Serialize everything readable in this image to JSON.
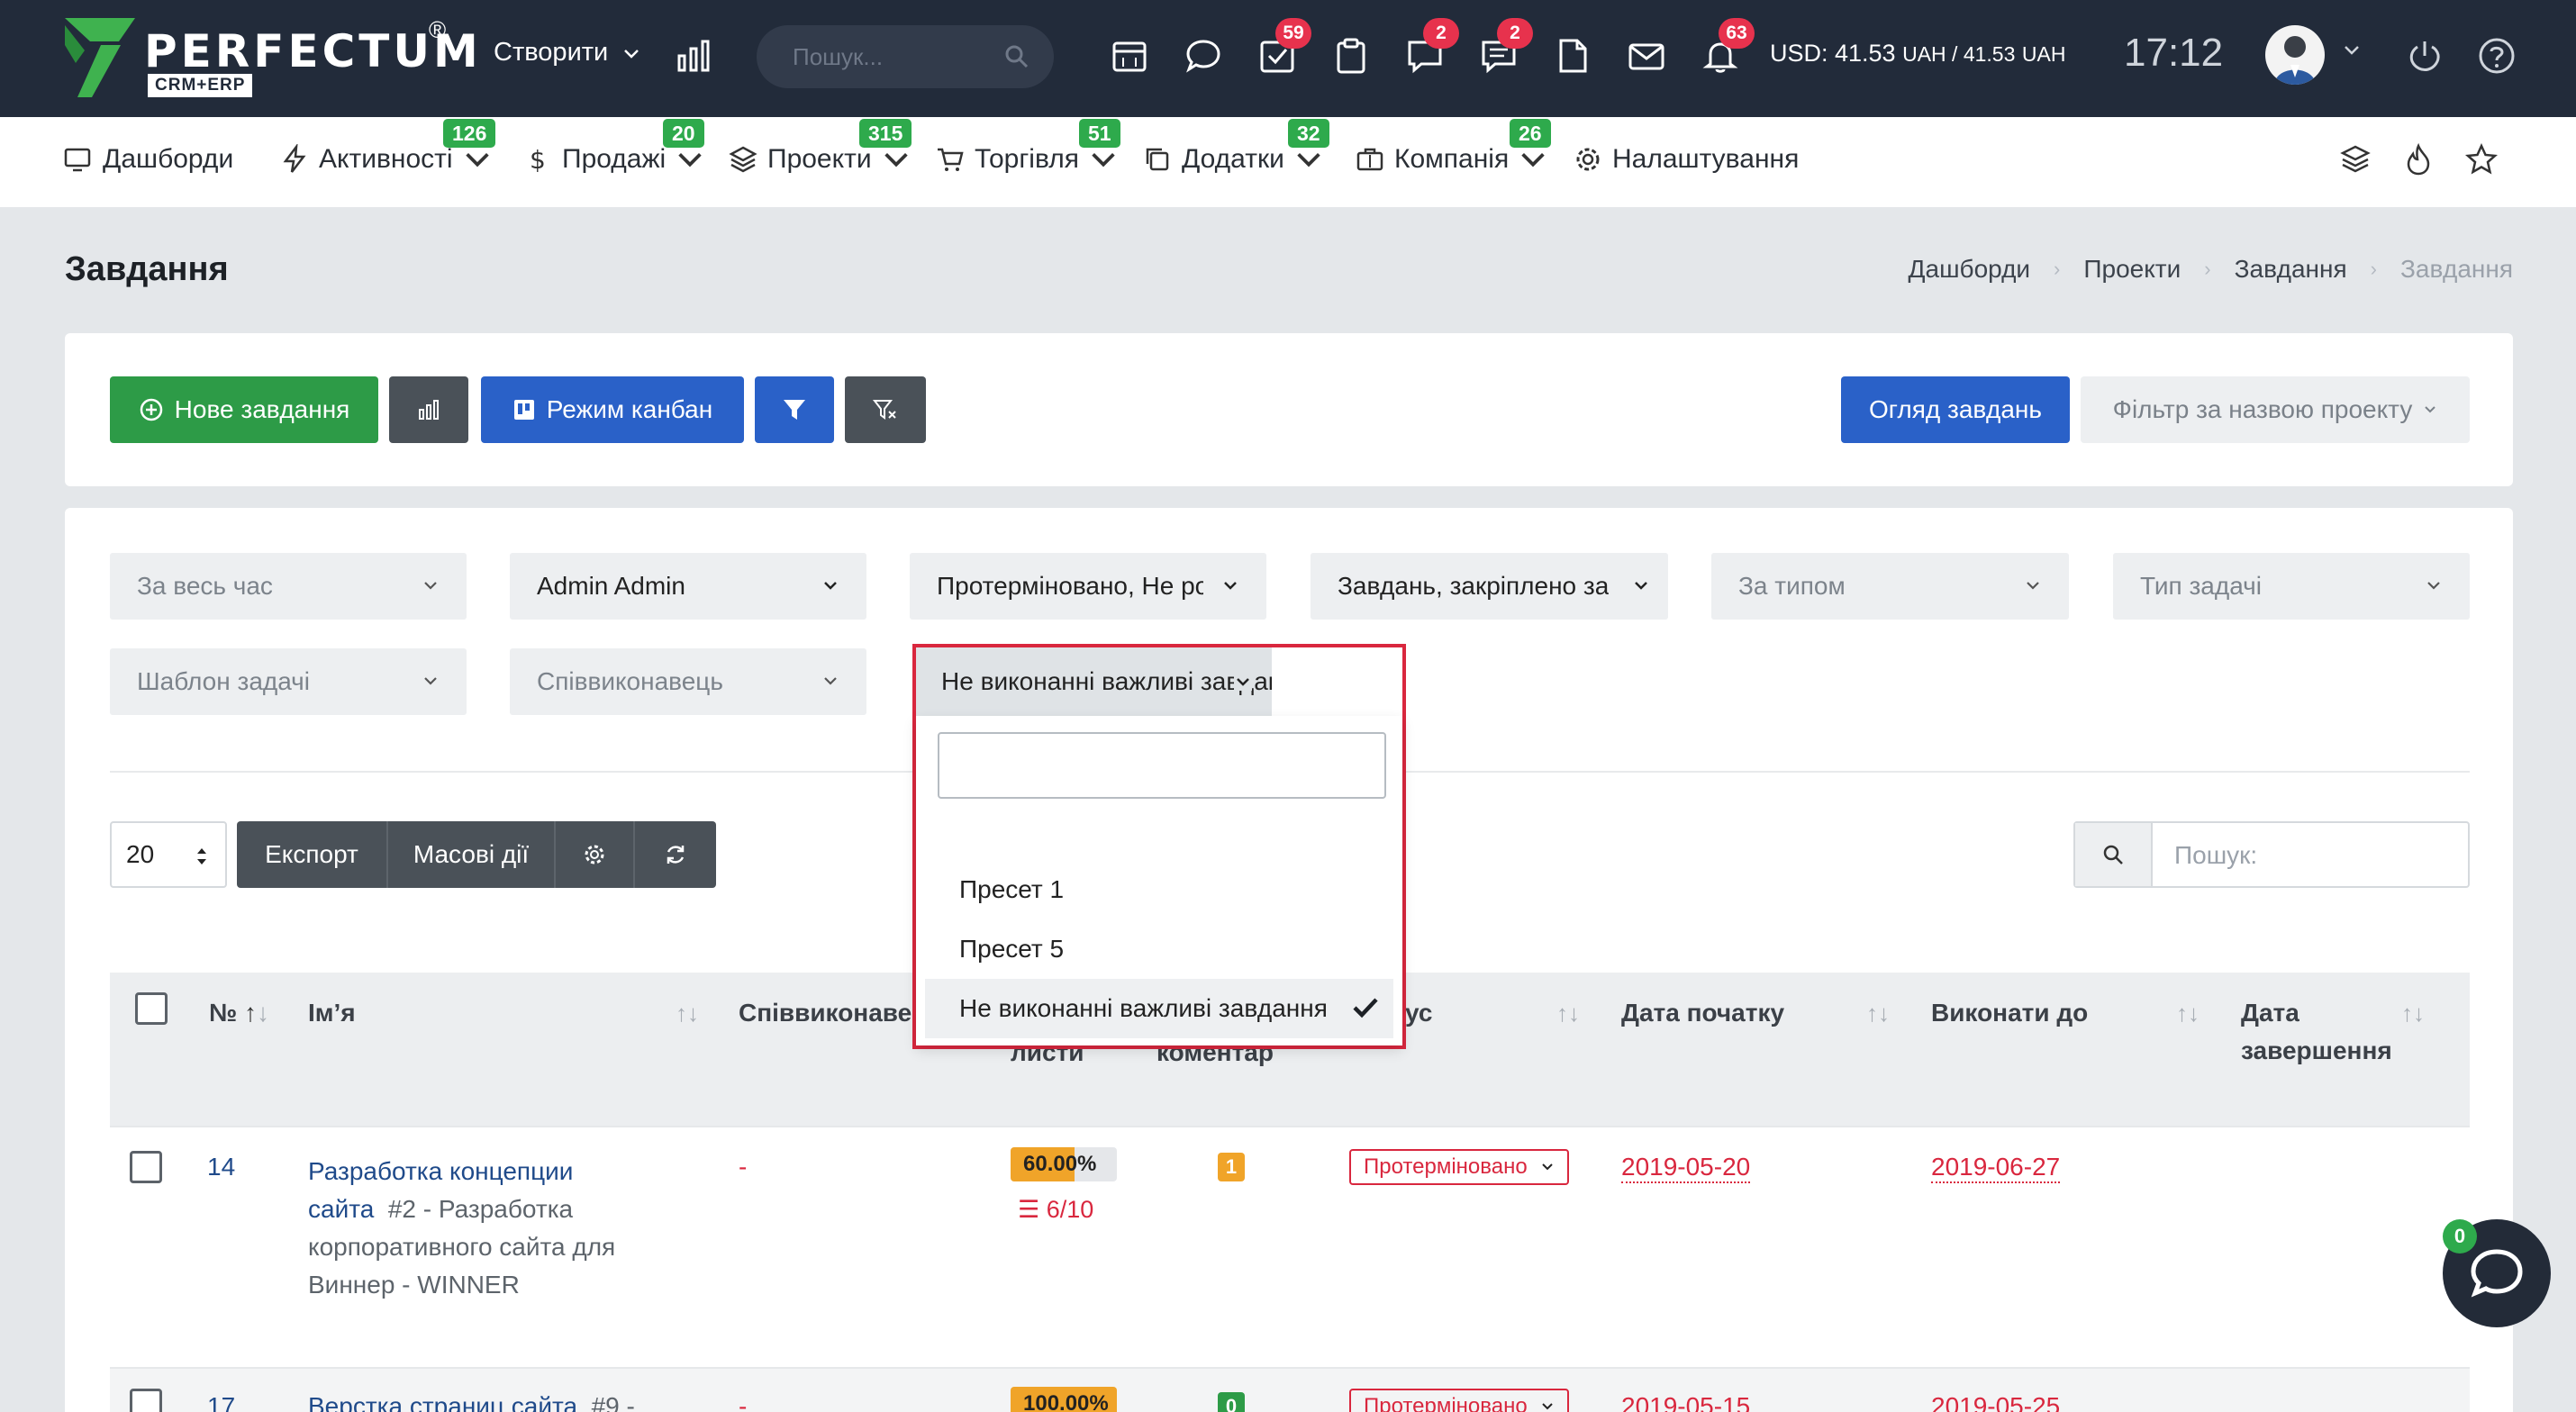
{
  "app": {
    "brand": "PERFECTUM",
    "brand_reg": "®",
    "brand_sub": "CRM+ERP",
    "create_label": "Створити",
    "search_placeholder": "Пошук...",
    "currency_usd": "USD: 41.53",
    "currency_mid": "UAH / 41.53",
    "currency_uah": "UAH",
    "time": "17:12",
    "badges": {
      "tasks": "59",
      "chat": "2",
      "discuss": "2",
      "notifications": "63"
    }
  },
  "nav": [
    {
      "label": "Дашборди",
      "badge": ""
    },
    {
      "label": "Активності",
      "badge": "126"
    },
    {
      "label": "Продажі",
      "badge": "20"
    },
    {
      "label": "Проекти",
      "badge": "315"
    },
    {
      "label": "Торгівля",
      "badge": "51"
    },
    {
      "label": "Додатки",
      "badge": "32"
    },
    {
      "label": "Компанія",
      "badge": "26"
    },
    {
      "label": "Налаштування",
      "badge": ""
    }
  ],
  "page": {
    "title": "Завдання",
    "breadcrumb": [
      "Дашборди",
      "Проекти",
      "Завдання",
      "Завдання"
    ]
  },
  "toolbar": {
    "new_task": "Нове завдання",
    "kanban": "Режим канбан",
    "overview": "Огляд завдань",
    "project_filter": "Фільтр за назвою проекту"
  },
  "filters": {
    "period": "За весь час",
    "assignee": "Admin Admin",
    "status": "Протерміновано, Не розпочато",
    "assigned_to": "Завдань, закріплено за",
    "by_type": "За типом",
    "task_type": "Тип задачі",
    "template": "Шаблон задачі",
    "coexecutor": "Співвиконавець",
    "preset": "Не виконанні важливі завдання"
  },
  "dropdown": {
    "search_value": "",
    "options": [
      {
        "label": "Пресет 1",
        "selected": false
      },
      {
        "label": "Пресет 5",
        "selected": false
      },
      {
        "label": "Не виконанні важливі завдання",
        "selected": true
      }
    ]
  },
  "list": {
    "per_page": "20",
    "export": "Експорт",
    "mass_actions": "Масові дії",
    "search_placeholder": "Пошук:"
  },
  "table": {
    "headers": {
      "num": "№",
      "name": "Ім’я",
      "coexec": "Співвиконавець",
      "checklists": "листи",
      "comments": "коментар",
      "status": "ус",
      "start": "Дата початку",
      "due": "Виконати до",
      "finish_line1": "Дата",
      "finish_line2": "завершення"
    },
    "rows": [
      {
        "id": "14",
        "name_line1": "Разработка концепции",
        "name_line2": "сайта",
        "project_line1": "#2 - Разработка",
        "project_line2": "корпоративного сайта для",
        "project_line3": "Виннер - WINNER",
        "coexec": "-",
        "progress_label": "60.00%",
        "progress": 0.6,
        "checklist": "6/10",
        "comments": "1",
        "comments_color": "#f0a429",
        "status": "Протерміновано",
        "start": "2019-05-20",
        "due": "2019-06-27"
      },
      {
        "id": "17",
        "name_line1": "Верстка страниц сайта",
        "project_line1": "#9 -",
        "coexec": "-",
        "progress_label": "100.00%",
        "progress": 1.0,
        "comments": "0",
        "comments_color": "#2d9b47",
        "status": "Протерміновано",
        "start": "2019-05-15",
        "due": "2019-05-25"
      }
    ]
  },
  "chat": {
    "count": "0"
  },
  "colors": {
    "topbar": "#222b3a",
    "accent_green": "#2d9b47",
    "accent_blue": "#2a61c8",
    "danger": "#d9273e",
    "badge_red": "#e7324d",
    "progress": "#f0a429"
  }
}
